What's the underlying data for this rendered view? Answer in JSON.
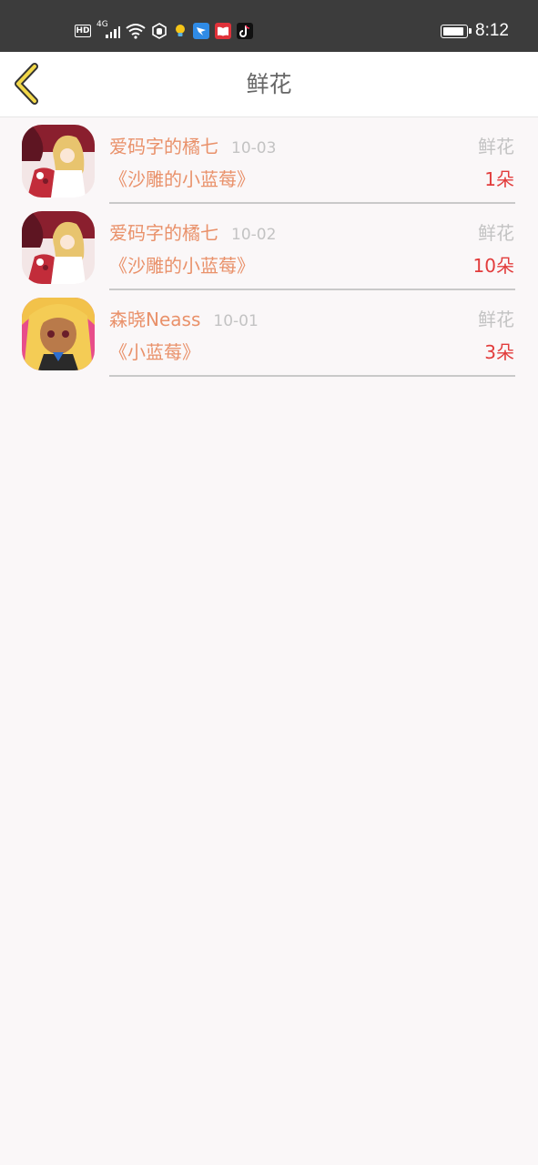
{
  "status_bar": {
    "network_label": "HD",
    "signal_label": "4G",
    "time": "8:12"
  },
  "header": {
    "title": "鲜花",
    "back_icon": "chevron-left-icon"
  },
  "colors": {
    "accent_name": "#e9916a",
    "count_red": "#e23c3c",
    "muted": "#c3c3c3"
  },
  "items": [
    {
      "user": "爱码字的橘七",
      "date": "10-03",
      "type": "鲜花",
      "book": "《沙雕的小蓝莓》",
      "count": "1朵"
    },
    {
      "user": "爱码字的橘七",
      "date": "10-02",
      "type": "鲜花",
      "book": "《沙雕的小蓝莓》",
      "count": "10朵"
    },
    {
      "user": "森晓Neass",
      "date": "10-01",
      "type": "鲜花",
      "book": "《小蓝莓》",
      "count": "3朵"
    }
  ]
}
